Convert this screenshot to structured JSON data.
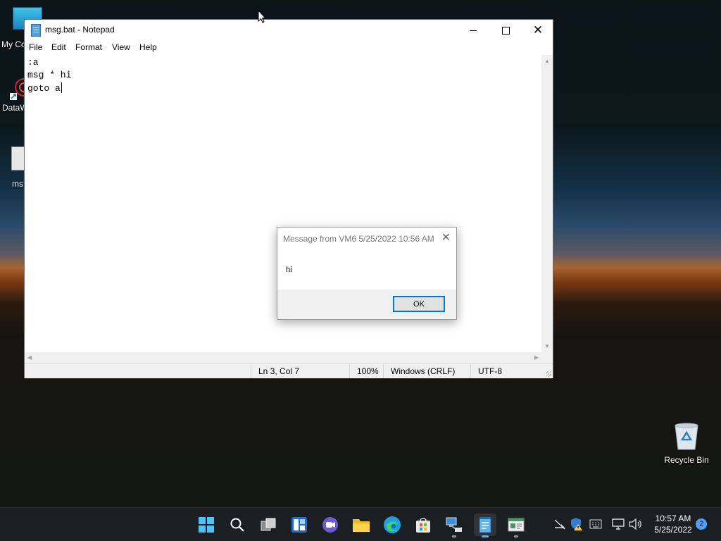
{
  "desktop": {
    "icons": [
      {
        "label": "My Co"
      },
      {
        "label": "DataW"
      },
      {
        "label": "ms"
      }
    ],
    "recycle_bin": {
      "label": "Recycle Bin"
    }
  },
  "notepad": {
    "title": "msg.bat - Notepad",
    "menu": [
      "File",
      "Edit",
      "Format",
      "View",
      "Help"
    ],
    "lines": [
      ":a",
      "msg * hi",
      "goto a"
    ],
    "status": {
      "position": "Ln 3, Col 7",
      "zoom": "100%",
      "line_ending": "Windows (CRLF)",
      "encoding": "UTF-8"
    }
  },
  "dialog": {
    "title": "Message from VM6 5/25/2022 10:56 AM",
    "message": "hi",
    "ok_label": "OK"
  },
  "taskbar": {
    "apps": [
      "start",
      "search",
      "task-view",
      "widgets",
      "chat",
      "file-explorer",
      "edge",
      "store",
      "network-tool",
      "notepad",
      "command-window"
    ],
    "time": "10:57 AM",
    "date": "5/25/2022",
    "notification_count": "2"
  },
  "colors": {
    "accent": "#0078d7",
    "taskbar": "#1c1f22"
  }
}
